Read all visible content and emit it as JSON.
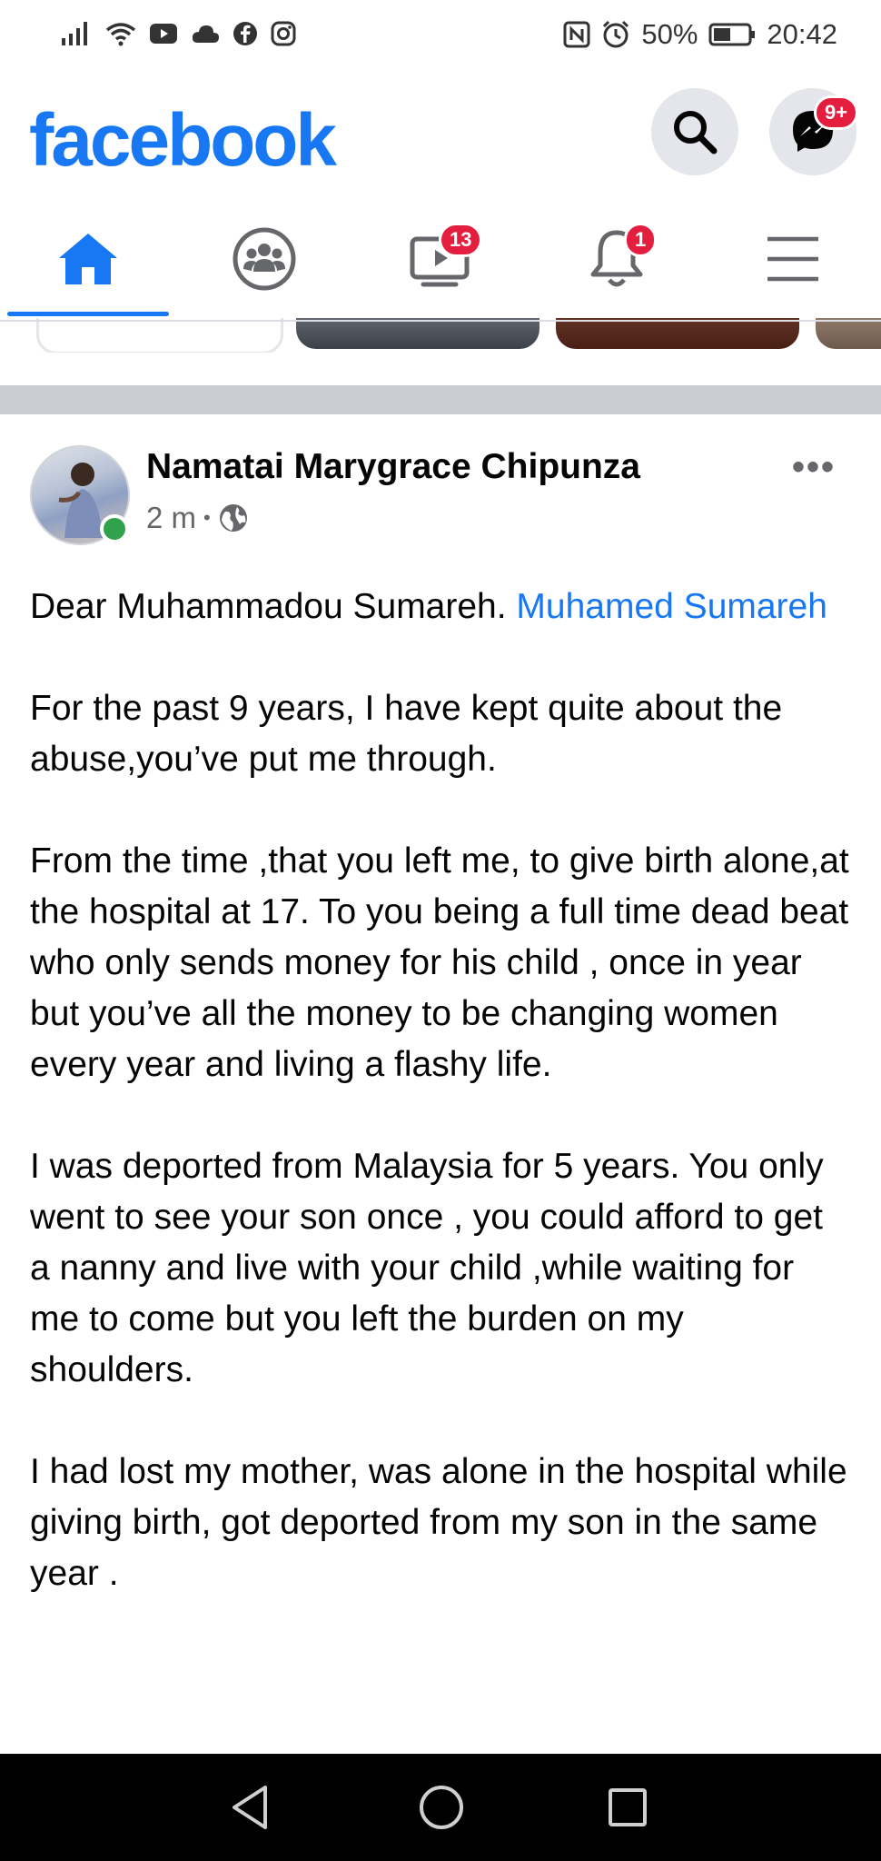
{
  "status_bar": {
    "battery": "50%",
    "time": "20:42",
    "icons_left": [
      "signal-icon",
      "wifi-icon",
      "youtube-icon",
      "cloud-icon",
      "facebook-icon",
      "instagram-icon"
    ],
    "icons_right": [
      "nfc-icon",
      "alarm-icon",
      "battery-icon"
    ]
  },
  "header": {
    "logo": "facebook",
    "messenger_badge": "9+",
    "brand_color": "#1877f2"
  },
  "nav": {
    "watch_badge": "13",
    "notifications_badge": "1"
  },
  "post": {
    "author": "Namatai Marygrace Chipunza",
    "time": "2 m",
    "separator": "•",
    "greeting": "Dear Muhammadou Sumareh. ",
    "mention": "Muhamed Sumareh",
    "paragraphs": [
      "For the past 9 years, I have kept  quite about the abuse,you’ve put me through.",
      "From the time ,that you left me, to give birth alone,at the hospital at 17. To you being a full time dead beat who only sends money for his child , once in year but you’ve all the money to be changing women every year and living a flashy life.",
      "I was deported from Malaysia for 5 years. You only went to see your son once , you could afford to get a nanny and live with your child ,while waiting for me to come but you left the burden on my shoulders.",
      "I had lost my mother, was alone in the hospital while giving birth, got deported from my son in the same year ."
    ]
  }
}
